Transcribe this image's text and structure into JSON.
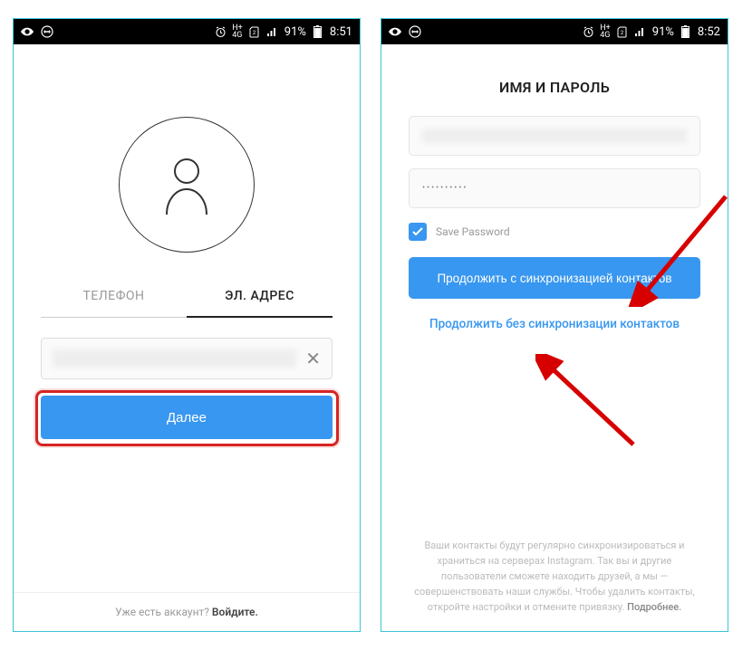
{
  "statusbar": {
    "battery_pct": "91%",
    "time_left": "8:51",
    "time_right": "8:52"
  },
  "left": {
    "tab_phone": "ТЕЛЕФОН",
    "tab_email": "ЭЛ. АДРЕС",
    "next_btn": "Далее",
    "footer_prefix": "Уже есть аккаунт? ",
    "footer_link": "Войдите."
  },
  "right": {
    "title": "ИМЯ И ПАРОЛЬ",
    "password_dots": "••••••••••",
    "save_pw": "Save Password",
    "sync_btn": "Продолжить с синхронизацией контактов",
    "nosync": "Продолжить без синхронизации контактов",
    "footer_body": "Ваши контакты будут регулярно синхронизироваться и храниться на серверах Instagram. Так вы и другие пользователи сможете находить друзей, а мы — совершенствовать наши службы. Чтобы удалить контакты, откройте настройки и отмените привязку. ",
    "footer_more": "Подробнее."
  }
}
